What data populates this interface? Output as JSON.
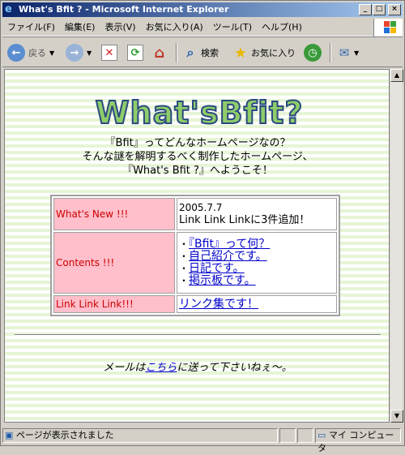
{
  "window": {
    "title": "What's Bfit ? - Microsoft Internet Explorer"
  },
  "menu": [
    "ファイル(F)",
    "編集(E)",
    "表示(V)",
    "お気に入り(A)",
    "ツール(T)",
    "ヘルプ(H)"
  ],
  "toolbar": {
    "back_label": "戻る",
    "search_label": "検索",
    "favorites_label": "お気に入り"
  },
  "page": {
    "logo": "What'sBfit?",
    "intro_lines": [
      "『Bfit』ってどんなホームページなの？",
      "そんな謎を解明するべく制作したホームページ、",
      "『What's Bfit ?』へようこそ！"
    ],
    "rows": {
      "new": {
        "heading": "What's New !!!",
        "date": "2005.7.7",
        "text": "Link Link Linkに3件追加！"
      },
      "contents": {
        "heading": "Contents !!!",
        "links": [
          "『Bfit』って何？",
          "自己紹介です。",
          "日記です。",
          "掲示板です。"
        ]
      },
      "links": {
        "heading": "Link Link Link!!!",
        "link": "リンク集です！"
      }
    },
    "mail": {
      "before": "メールは",
      "link": "こちら",
      "after": "に送って下さいねぇ〜。"
    }
  },
  "status": {
    "text": "ページが表示されました",
    "zone": "マイ コンピュータ"
  },
  "colors": {
    "title_start": "#0a246a",
    "heading_bg": "#ffbfcb",
    "heading_fg": "#cc0000",
    "link": "#0000cc"
  }
}
